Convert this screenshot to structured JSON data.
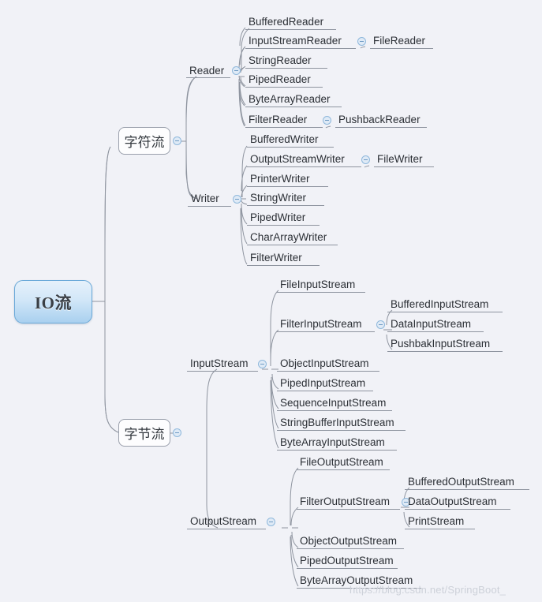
{
  "meta": {
    "background_color": "#f1f2f7",
    "connector_color": "#8e949f",
    "accent_color": "#6aa9d8",
    "toggle_color": "#dfeaf6"
  },
  "watermark": {
    "text": "https://blog.csdn.net/SpringBoot_"
  },
  "root": {
    "label": "IO流"
  },
  "branches": [
    {
      "label": "字符流",
      "toggle": "collapse-toggle",
      "children": [
        {
          "label": "Reader",
          "toggle": "collapse-toggle",
          "children": [
            {
              "label": "BufferedReader"
            },
            {
              "label": "InputStreamReader",
              "toggle": "collapse-toggle",
              "children": [
                {
                  "label": "FileReader"
                }
              ]
            },
            {
              "label": "StringReader"
            },
            {
              "label": "PipedReader"
            },
            {
              "label": "ByteArrayReader"
            },
            {
              "label": "FilterReader",
              "toggle": "collapse-toggle",
              "children": [
                {
                  "label": "PushbackReader"
                }
              ]
            }
          ]
        },
        {
          "label": "Writer",
          "toggle": "collapse-toggle",
          "children": [
            {
              "label": "BufferedWriter"
            },
            {
              "label": "OutputStreamWriter",
              "toggle": "collapse-toggle",
              "children": [
                {
                  "label": "FileWriter"
                }
              ]
            },
            {
              "label": "PrinterWriter"
            },
            {
              "label": "StringWriter"
            },
            {
              "label": "PipedWriter"
            },
            {
              "label": "CharArrayWriter"
            },
            {
              "label": "FilterWriter"
            }
          ]
        }
      ]
    },
    {
      "label": "字节流",
      "toggle": "collapse-toggle",
      "children": [
        {
          "label": "InputStream",
          "toggle": "collapse-toggle",
          "children": [
            {
              "label": "FileInputStream"
            },
            {
              "label": "FilterInputStream",
              "toggle": "collapse-toggle",
              "children": [
                {
                  "label": "BufferedInputStream"
                },
                {
                  "label": "DataInputStream"
                },
                {
                  "label": "PushbakInputStream"
                }
              ]
            },
            {
              "label": "ObjectInputStream"
            },
            {
              "label": "PipedInputStream"
            },
            {
              "label": "SequenceInputStream"
            },
            {
              "label": "StringBufferInputStream"
            },
            {
              "label": "ByteArrayInputStream"
            }
          ]
        },
        {
          "label": "OutputStream",
          "toggle": "collapse-toggle",
          "children": [
            {
              "label": "FileOutputStream"
            },
            {
              "label": "FilterOutputStream",
              "toggle": "collapse-toggle",
              "children": [
                {
                  "label": "BufferedOutputStream"
                },
                {
                  "label": "DataOutputStream"
                },
                {
                  "label": "PrintStream"
                }
              ]
            },
            {
              "label": "ObjectOutputStream"
            },
            {
              "label": "PipedOutputStream"
            },
            {
              "label": "ByteArrayOutputStream"
            }
          ]
        }
      ]
    }
  ]
}
